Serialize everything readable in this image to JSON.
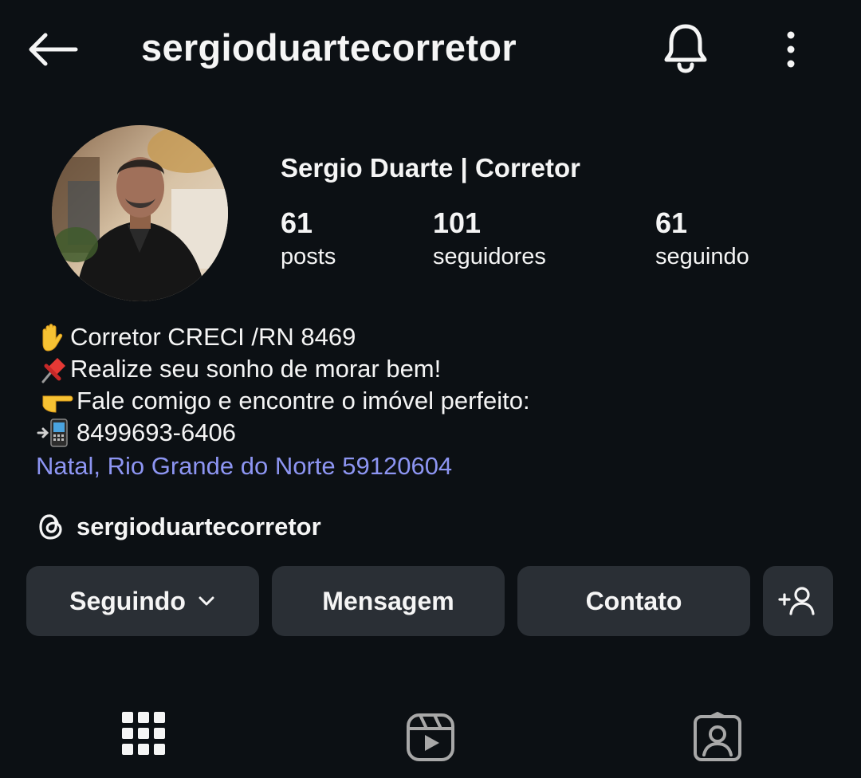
{
  "header": {
    "title": "sergioduartecorretor",
    "back_icon": "arrow-left-icon",
    "bell_icon": "bell-icon",
    "more_icon": "more-vertical-icon"
  },
  "profile": {
    "display_name": "Sergio Duarte | Corretor",
    "stats": {
      "posts": {
        "value": "61",
        "label": "posts"
      },
      "followers": {
        "value": "101",
        "label": "seguidores"
      },
      "following": {
        "value": "61",
        "label": "seguindo"
      }
    },
    "bio": [
      {
        "emoji": "raised-hand",
        "text": "Corretor CRECI /RN 8469"
      },
      {
        "emoji": "pushpin",
        "text": "Realize seu sonho de morar bem!"
      },
      {
        "emoji": "pointing-hand",
        "text": "Fale comigo e encontre o imóvel perfeito:"
      },
      {
        "emoji": "mobile-phone-arrow",
        "text": "8499693-6406"
      }
    ],
    "location": "Natal, Rio Grande do Norte 59120604",
    "threads_handle": "sergioduartecorretor"
  },
  "actions": {
    "following_label": "Seguindo",
    "message_label": "Mensagem",
    "contact_label": "Contato"
  },
  "tabs": [
    {
      "icon": "grid-icon",
      "selected": true
    },
    {
      "icon": "reels-icon",
      "selected": false
    },
    {
      "icon": "tagged-icon",
      "selected": false
    }
  ],
  "colors": {
    "background": "#0c1014",
    "button": "#2a2f35",
    "link": "#8d95f2",
    "text": "#f5f5f5",
    "inactive_icon": "#a8a8a8"
  }
}
